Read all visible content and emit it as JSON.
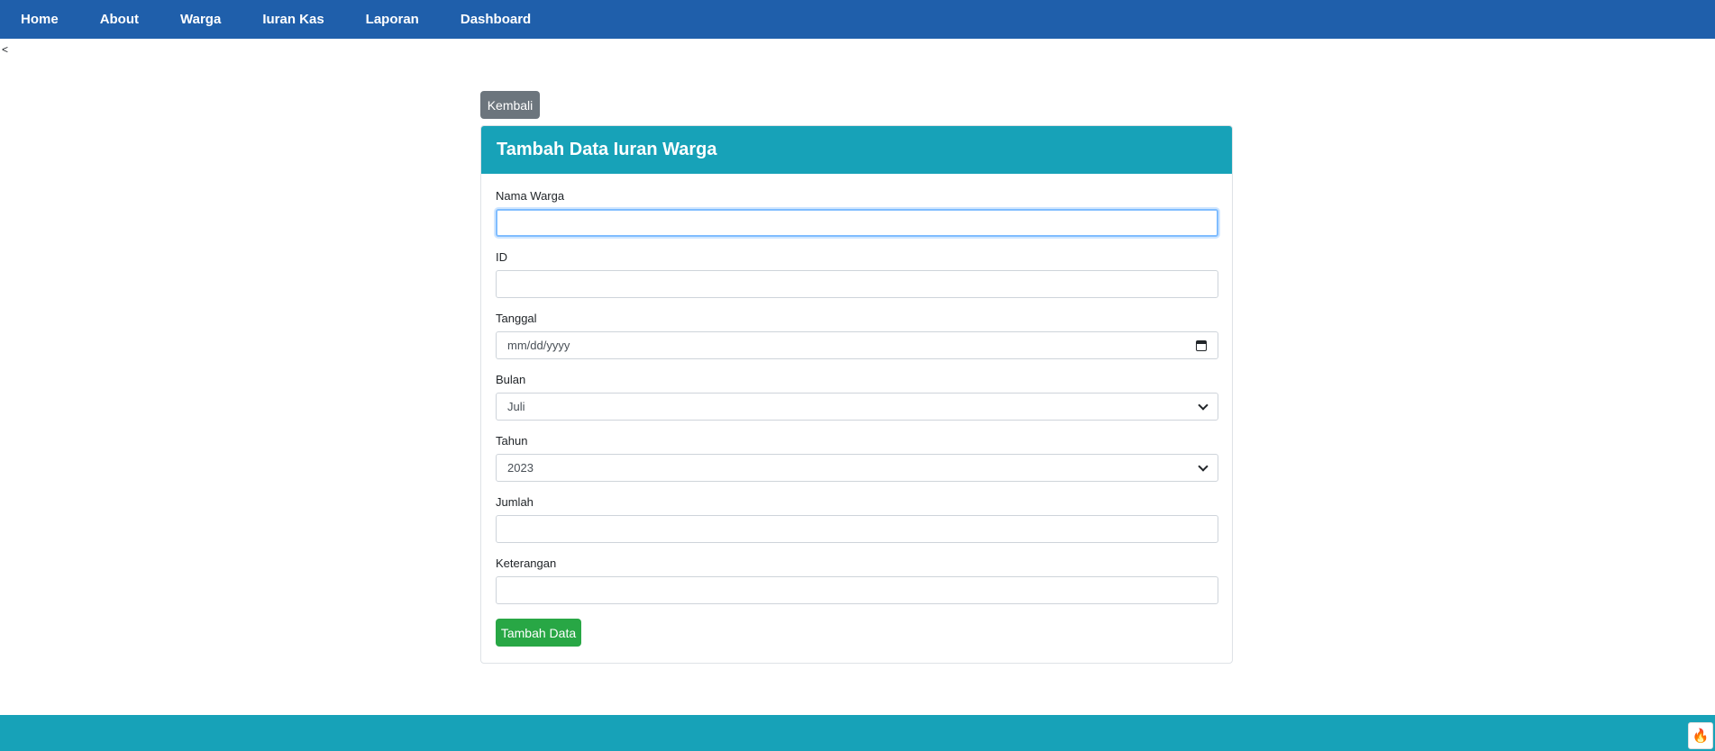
{
  "nav": {
    "items": [
      {
        "label": "Home"
      },
      {
        "label": "About"
      },
      {
        "label": "Warga"
      },
      {
        "label": "Iuran Kas"
      },
      {
        "label": "Laporan"
      },
      {
        "label": "Dashboard"
      }
    ]
  },
  "stray_text": "<",
  "back_button": {
    "label": "Kembali"
  },
  "card": {
    "title": "Tambah Data Iuran Warga",
    "fields": {
      "nama_warga": {
        "label": "Nama Warga",
        "value": ""
      },
      "id": {
        "label": "ID",
        "value": ""
      },
      "tanggal": {
        "label": "Tanggal",
        "placeholder": "mm/dd/yyyy"
      },
      "bulan": {
        "label": "Bulan",
        "selected": "Juli"
      },
      "tahun": {
        "label": "Tahun",
        "selected": "2023"
      },
      "jumlah": {
        "label": "Jumlah",
        "value": ""
      },
      "keterangan": {
        "label": "Keterangan",
        "value": ""
      }
    },
    "submit_label": "Tambah Data"
  },
  "colors": {
    "navbar": "#1f5fab",
    "card_header": "#17a2b8",
    "footer": "#17a2b8",
    "back_button": "#6c757d",
    "submit_button": "#28a745"
  },
  "icons": {
    "date_picker": "calendar-icon",
    "select": "chevron-down-icon",
    "corner": "flame-icon"
  }
}
